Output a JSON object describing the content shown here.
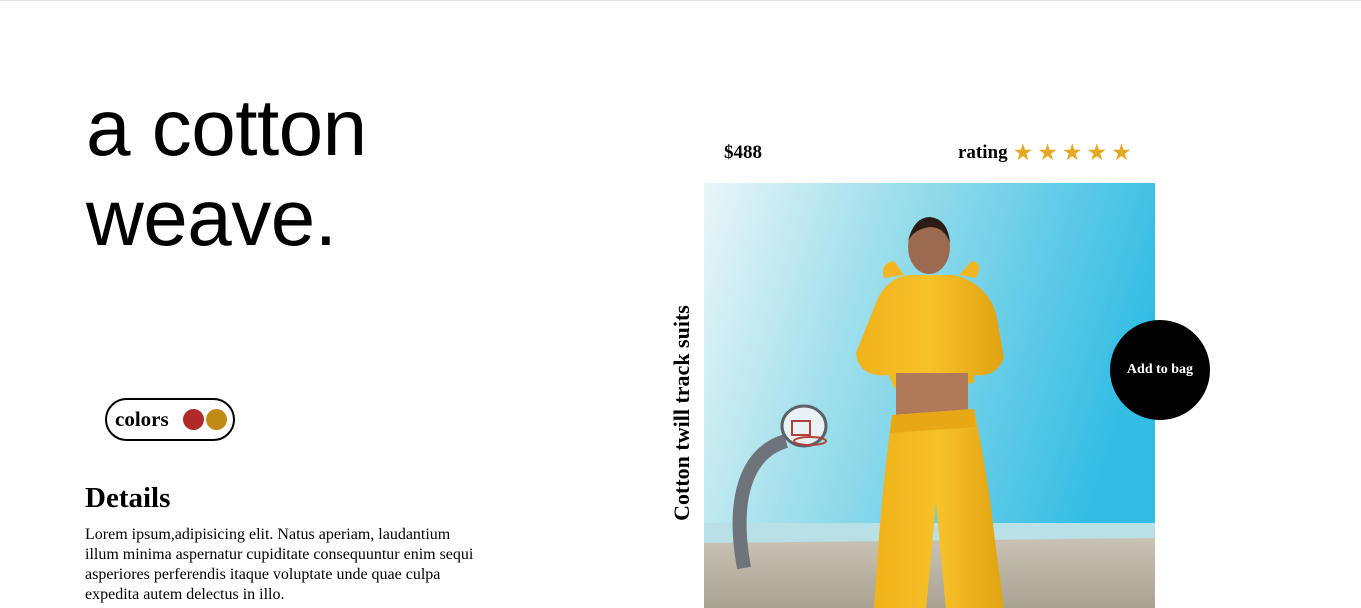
{
  "hero": {
    "line1": "a cotton",
    "line2": "weave."
  },
  "colors": {
    "label": "colors",
    "swatches": [
      "#b02a2a",
      "#c18a12"
    ]
  },
  "details": {
    "title": "Details",
    "text": "Lorem ipsum,adipisicing elit. Natus aperiam, laudantium illum minima aspernatur cupiditate consequuntur enim sequi asperiores perferendis itaque voluptate unde quae culpa expedita autem delectus in illo."
  },
  "product": {
    "price": "$488",
    "rating_label": "rating",
    "rating_stars": 5,
    "star_color": "#e5a824",
    "name": "Cotton twill track suits",
    "image_icon": "tracksuit-photo",
    "add_to_bag_label": "Add to bag"
  }
}
